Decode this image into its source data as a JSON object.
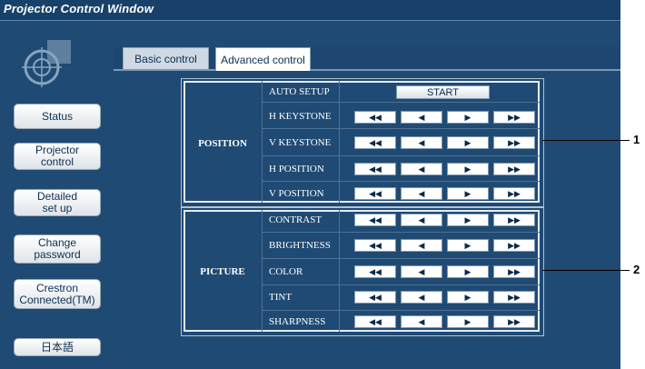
{
  "window": {
    "title": "Projector Control Window"
  },
  "sidebar": {
    "items": [
      {
        "label": "Status"
      },
      {
        "label": "Projector\ncontrol"
      },
      {
        "label": "Detailed\nset up"
      },
      {
        "label": "Change\npassword"
      },
      {
        "label": "Crestron\nConnected(TM)"
      },
      {
        "label": "日本語"
      }
    ]
  },
  "tabs": [
    {
      "label": "Basic control",
      "active": false
    },
    {
      "label": "Advanced control",
      "active": true
    }
  ],
  "position": {
    "label": "POSITION",
    "auto_setup": {
      "label": "AUTO SETUP",
      "button": "START"
    },
    "rows": [
      {
        "label": "H KEYSTONE"
      },
      {
        "label": "V KEYSTONE"
      },
      {
        "label": "H POSITION"
      },
      {
        "label": "V POSITION"
      }
    ]
  },
  "picture": {
    "label": "PICTURE",
    "rows": [
      {
        "label": "CONTRAST"
      },
      {
        "label": "BRIGHTNESS"
      },
      {
        "label": "COLOR"
      },
      {
        "label": "TINT"
      },
      {
        "label": "SHARPNESS"
      }
    ]
  },
  "control_buttons": [
    "◀◀",
    "◀",
    "▶",
    "▶▶"
  ],
  "callouts": [
    "1",
    "2"
  ],
  "colors": {
    "window_bg": "#1f4a74",
    "button_text": "#0c2f53"
  }
}
